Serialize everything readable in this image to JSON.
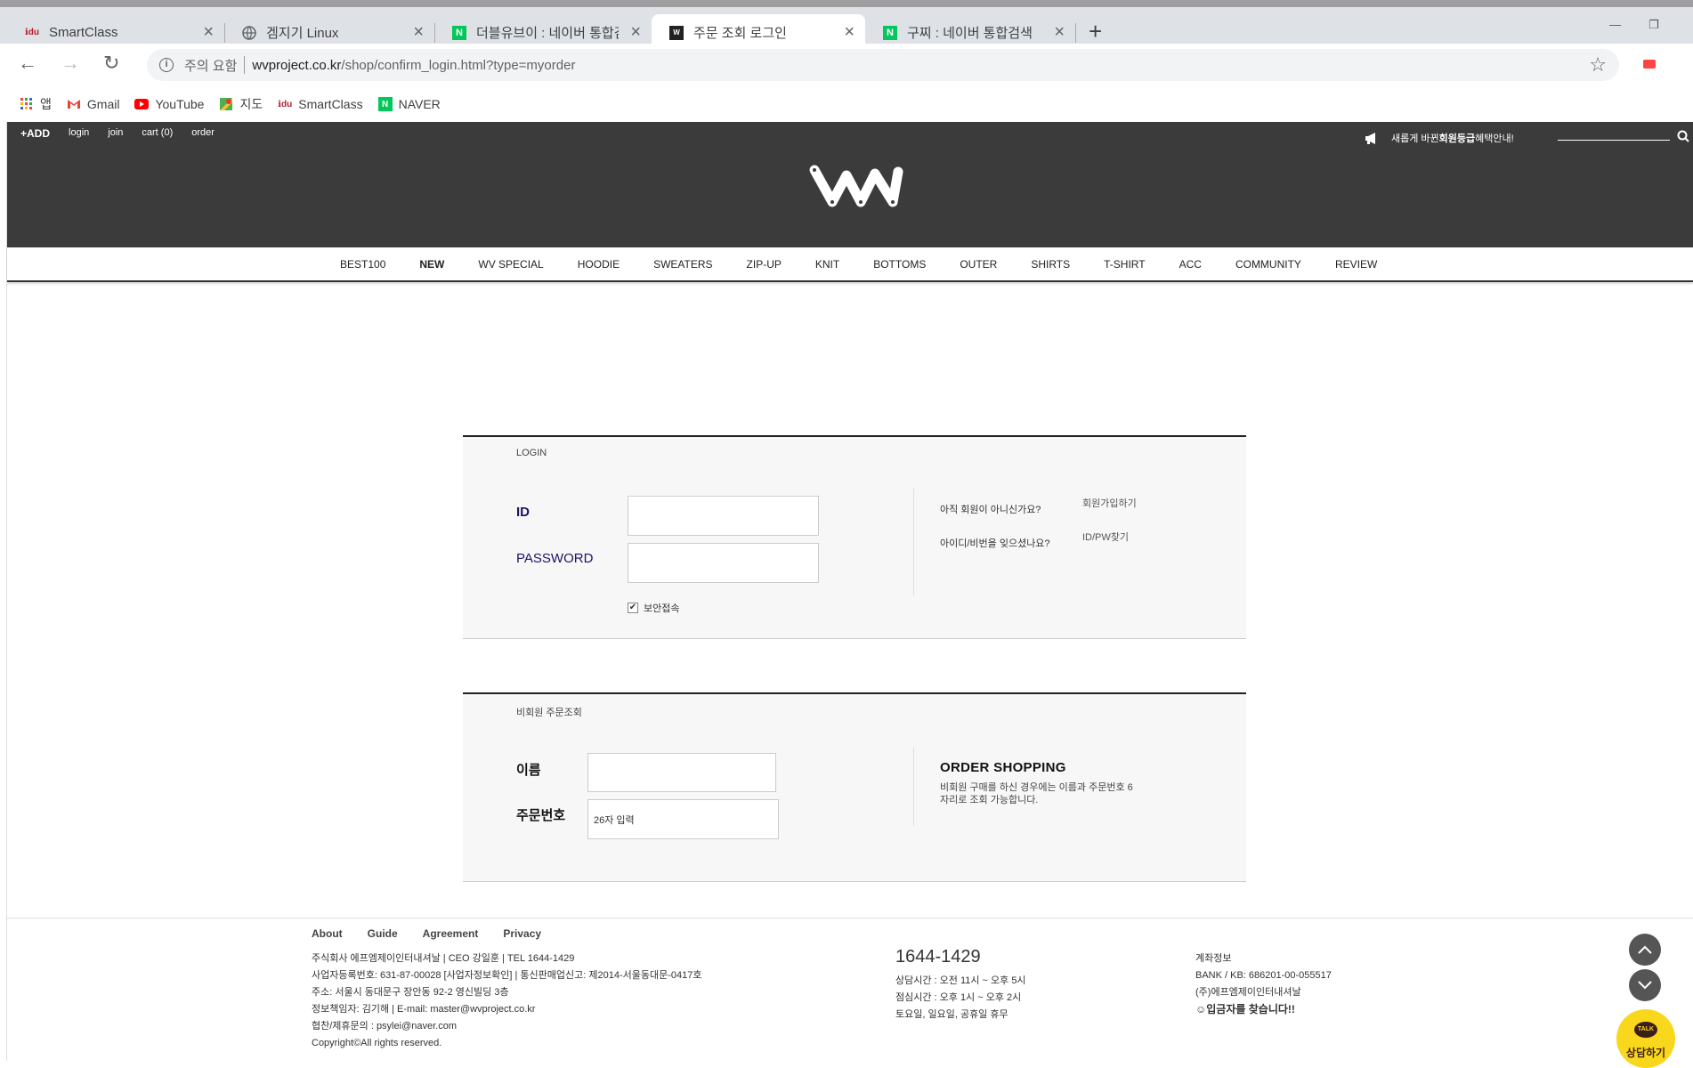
{
  "browser": {
    "tabs": [
      {
        "title": "SmartClass",
        "favicon": "smartclass-favicon",
        "active": false
      },
      {
        "title": "겜지기 Linux",
        "favicon": "globe-icon",
        "active": false
      },
      {
        "title": "더블유브이 : 네이버 통합검색",
        "favicon": "naver-favicon",
        "active": false
      },
      {
        "title": "주문 조회 로그인",
        "favicon": "wv-favicon",
        "active": true
      },
      {
        "title": "구찌 : 네이버 통합검색",
        "favicon": "naver-favicon",
        "active": false
      }
    ],
    "new_tab": "+",
    "address": {
      "warning": "주의 요함",
      "host": "wvproject.co.kr",
      "path": "/shop/confirm_login.html?type=myorder"
    },
    "bookmarks": [
      {
        "label": "앱",
        "icon": "apps-grid-icon"
      },
      {
        "label": "Gmail",
        "icon": "gmail-icon"
      },
      {
        "label": "YouTube",
        "icon": "youtube-icon"
      },
      {
        "label": "지도",
        "icon": "maps-icon"
      },
      {
        "label": "SmartClass",
        "icon": "smartclass-favicon"
      },
      {
        "label": "NAVER",
        "icon": "naver-favicon"
      }
    ]
  },
  "site": {
    "top_menu": [
      "+ADD",
      "login",
      "join",
      "cart (0)",
      "order"
    ],
    "promo": {
      "pre": "새롭게 바뀐 ",
      "bold": "회원등급",
      "post": " 혜택안내!"
    },
    "logo": "wv-logo",
    "gnb": [
      "BEST100",
      "NEW",
      "WV SPECIAL",
      "HOODIE",
      "SWEATERS",
      "ZIP-UP",
      "KNIT",
      "BOTTOMS",
      "OUTER",
      "SHIRTS",
      "T-SHIRT",
      "ACC",
      "COMMUNITY",
      "REVIEW"
    ]
  },
  "login": {
    "title": "LOGIN",
    "id_label": "ID",
    "password_label": "PASSWORD",
    "secure": "보안접속",
    "not_member_q": "아직 회원이 아니신가요?",
    "join_link": "회원가입하기",
    "forgot_q": "아이디/비번을 잊으셨나요?",
    "find_link": "ID/PW찾기"
  },
  "guest": {
    "title": "비회원 주문조회",
    "name_label": "이름",
    "order_no_label": "주문번호",
    "order_no_placeholder": "26자 입력",
    "shop_title": "ORDER SHOPPING",
    "shop_desc": "비회원 구매를 하신 경우에는 이름과 주문번호 6자리로 조회 가능합니다."
  },
  "footer": {
    "nav": [
      "About",
      "Guide",
      "Agreement",
      "Privacy"
    ],
    "company": [
      "주식회사 에프엠제이인터내셔날 | CEO 강일훈 | TEL 1644-1429",
      "사업자등록번호: 631-87-00028 [사업자정보확인] | 통신판매업신고: 제2014-서울동대문-0417호",
      "주소: 서울시 동대문구 장안동 92-2 영신빌딩 3층",
      "정보책임자: 김기해 | E-mail: master@wvproject.co.kr",
      "협찬/제휴문의 : psylei@naver.com",
      "Copyright©All rights reserved."
    ],
    "cs_tel": "1644-1429",
    "cs_lines": [
      "상담시간 : 오전 11시 ~ 오후 5시",
      "점심시간 : 오후 1시 ~ 오후 2시",
      "토요일, 일요일, 공휴일 휴무"
    ],
    "bank_lines": [
      "계좌정보",
      "BANK / KB: 686201-00-055517",
      "(주)에프엠제이인터내셔날"
    ],
    "bank_find": "☺입금자를 찾습니다!!",
    "talk_bubble": "TALK",
    "talk_label": "상담하기"
  }
}
